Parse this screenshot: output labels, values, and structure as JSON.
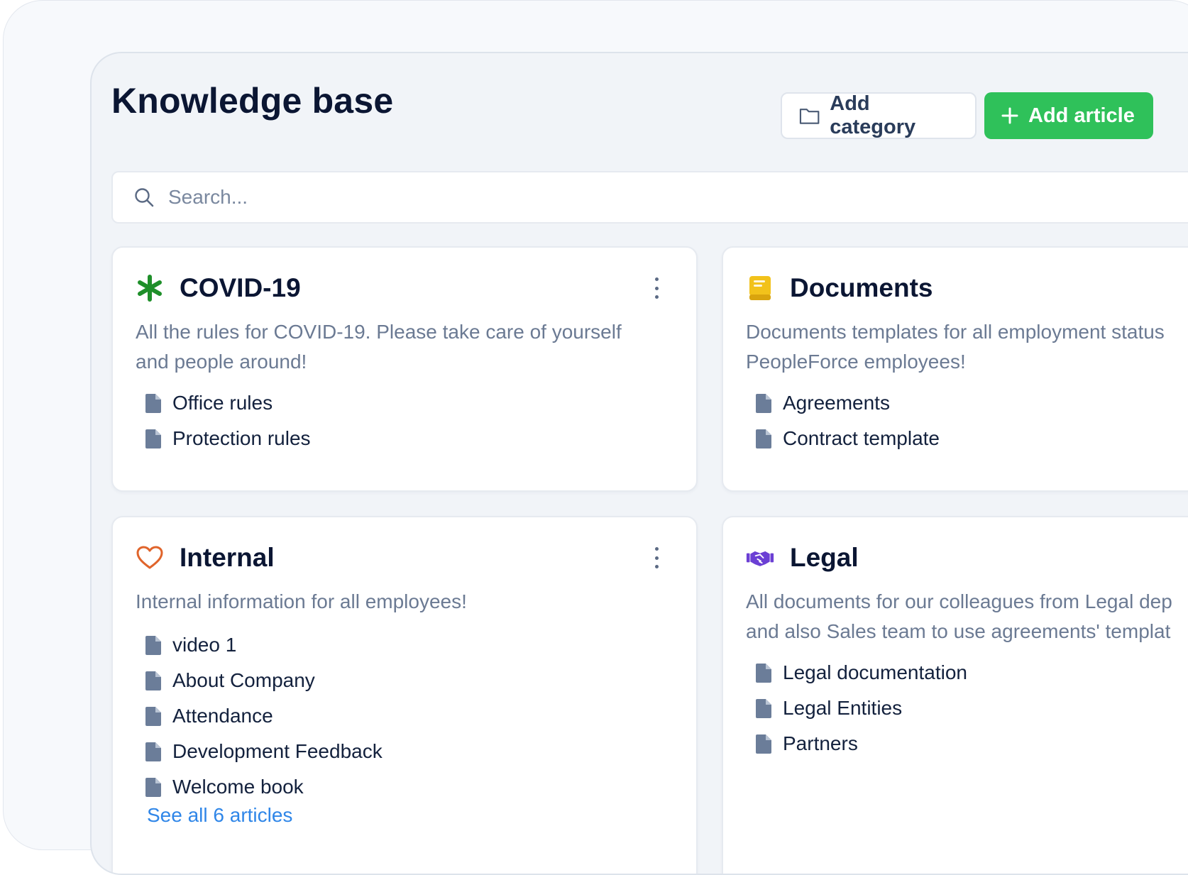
{
  "header": {
    "title": "Knowledge base",
    "add_category_label": "Add category",
    "add_article_label": "Add article"
  },
  "search": {
    "placeholder": "Search..."
  },
  "colors": {
    "accent_green": "#2fc15a",
    "link_blue": "#2f86e8",
    "covid_icon": "#1f8f2a",
    "documents_icon": "#f2c21b",
    "internal_icon": "#e0642b",
    "legal_icon": "#6b3fd4"
  },
  "categories": [
    {
      "title": "COVID-19",
      "icon": "asterisk-icon",
      "description": "All the rules for COVID-19. Please take care of yourself and people around!",
      "desc_lines": [
        "All the rules for COVID-19. Please take care of yourself",
        "and people around!"
      ],
      "articles": [
        "Office rules",
        "Protection rules"
      ]
    },
    {
      "title": "Documents",
      "icon": "book-icon",
      "description": "Documents templates for all employment status PeopleForce employees!",
      "desc_lines": [
        "Documents templates for all employment status",
        "PeopleForce employees!"
      ],
      "articles": [
        "Agreements",
        "Contract template"
      ]
    },
    {
      "title": "Internal",
      "icon": "heart-icon",
      "description": "Internal information for all employees!",
      "desc_lines": [
        "Internal information for all employees!"
      ],
      "articles": [
        "video 1",
        "About Company",
        "Attendance",
        "Development Feedback",
        "Welcome book"
      ],
      "see_all": "See all 6 articles"
    },
    {
      "title": "Legal",
      "icon": "handshake-icon",
      "description": "All documents for our colleagues from Legal dep and also Sales team to use agreements' templat",
      "desc_lines": [
        "All documents for our colleagues from Legal dep",
        "and also Sales team to use agreements' templat"
      ],
      "articles": [
        "Legal documentation",
        "Legal Entities",
        "Partners"
      ]
    }
  ]
}
